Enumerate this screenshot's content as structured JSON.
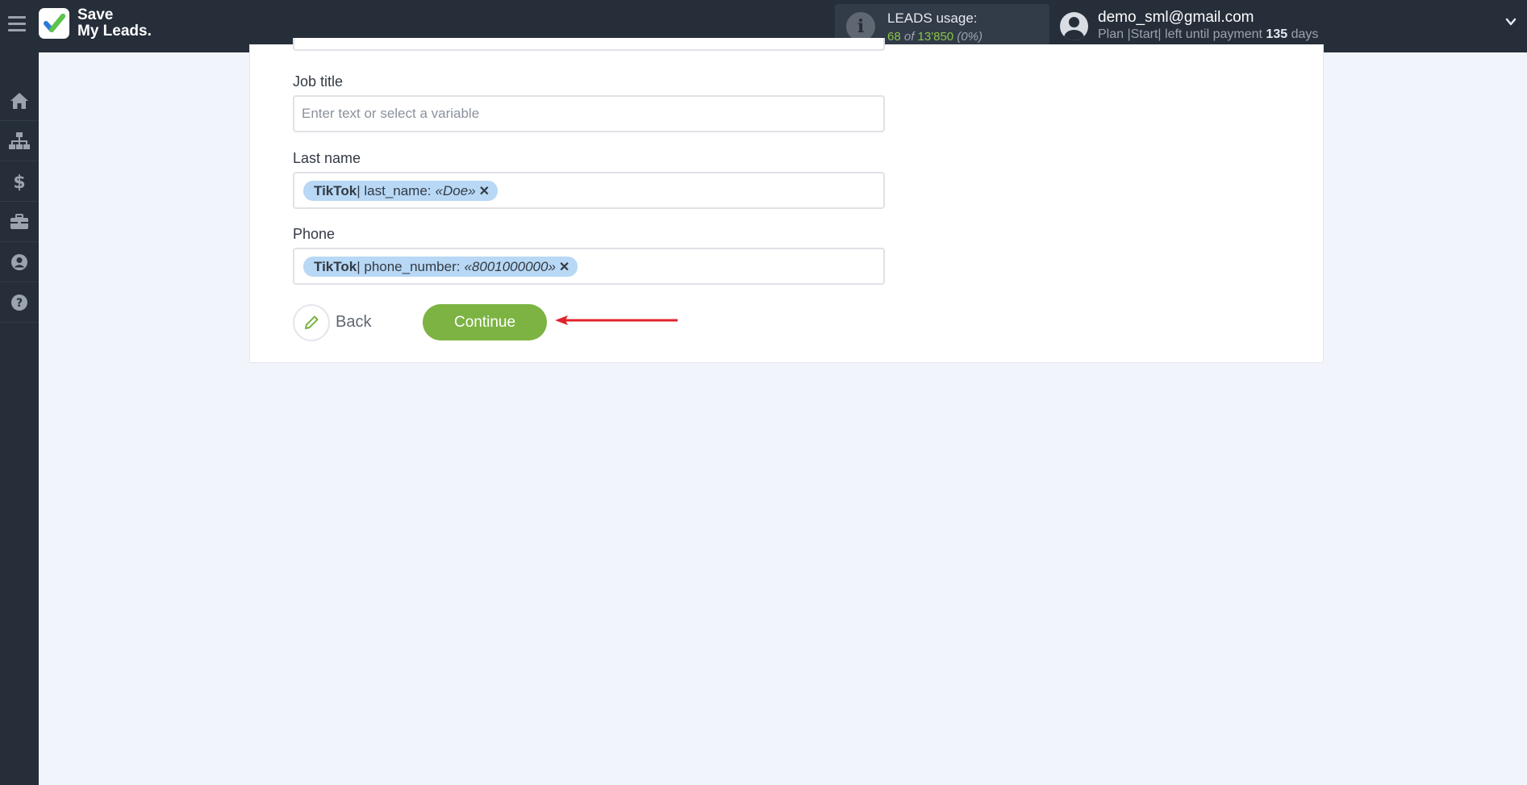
{
  "header": {
    "logo": {
      "line1": "Save",
      "line2": "My Leads."
    },
    "usage": {
      "title": "LEADS usage:",
      "used": "68",
      "of": "of",
      "total": "13'850",
      "percent": "(0%)"
    },
    "user": {
      "email": "demo_sml@gmail.com",
      "plan_text": "Plan |Start| left until payment",
      "days": "135",
      "days_suffix": "days"
    }
  },
  "sidebar": {
    "items": [
      {
        "icon": "home-icon"
      },
      {
        "icon": "sitemap-icon"
      },
      {
        "icon": "dollar-icon"
      },
      {
        "icon": "briefcase-icon"
      },
      {
        "icon": "user-circle-icon"
      },
      {
        "icon": "help-circle-icon"
      }
    ]
  },
  "form": {
    "job_title": {
      "label": "Job title",
      "placeholder": "Enter text or select a variable"
    },
    "last_name": {
      "label": "Last name",
      "tag": {
        "source": "TikTok",
        "field": " | last_name:",
        "value": "«Doe»"
      }
    },
    "phone": {
      "label": "Phone",
      "tag": {
        "source": "TikTok",
        "field": " | phone_number:",
        "value": "«8001000000»"
      }
    },
    "back_label": "Back",
    "continue_label": "Continue"
  },
  "colors": {
    "topbar": "#262e3a",
    "accent_green": "#7cb342",
    "tag_blue": "#b8d8f5",
    "arrow_red": "#e0242b"
  }
}
